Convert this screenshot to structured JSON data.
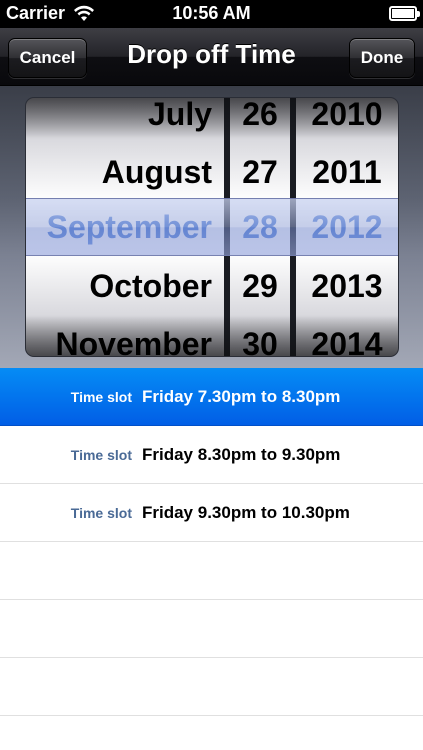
{
  "status_bar": {
    "carrier": "Carrier",
    "time": "10:56 AM",
    "wifi_icon": "wifi-icon",
    "battery_icon": "battery-icon"
  },
  "nav_bar": {
    "title": "Drop off Time",
    "cancel_label": "Cancel",
    "done_label": "Done"
  },
  "picker": {
    "months": [
      "July",
      "August",
      "September",
      "October",
      "November"
    ],
    "days": [
      "26",
      "27",
      "28",
      "29",
      "30"
    ],
    "years": [
      "2010",
      "2011",
      "2012",
      "2013",
      "2014"
    ],
    "selected_month": "September",
    "selected_day": "28",
    "selected_year": "2012",
    "selected_color": "#4a7ad6"
  },
  "time_slots": [
    {
      "label": "Time slot",
      "value": "Friday 7.30pm to 8.30pm",
      "selected": true
    },
    {
      "label": "Time slot",
      "value": "Friday 8.30pm to 9.30pm",
      "selected": false
    },
    {
      "label": "Time slot",
      "value": "Friday 9.30pm to 10.30pm",
      "selected": false
    },
    {
      "label": "",
      "value": "",
      "selected": false
    },
    {
      "label": "",
      "value": "",
      "selected": false
    },
    {
      "label": "",
      "value": "",
      "selected": false
    }
  ],
  "colors": {
    "selected_row": "#015ee6",
    "label_text": "#4a6a96"
  }
}
